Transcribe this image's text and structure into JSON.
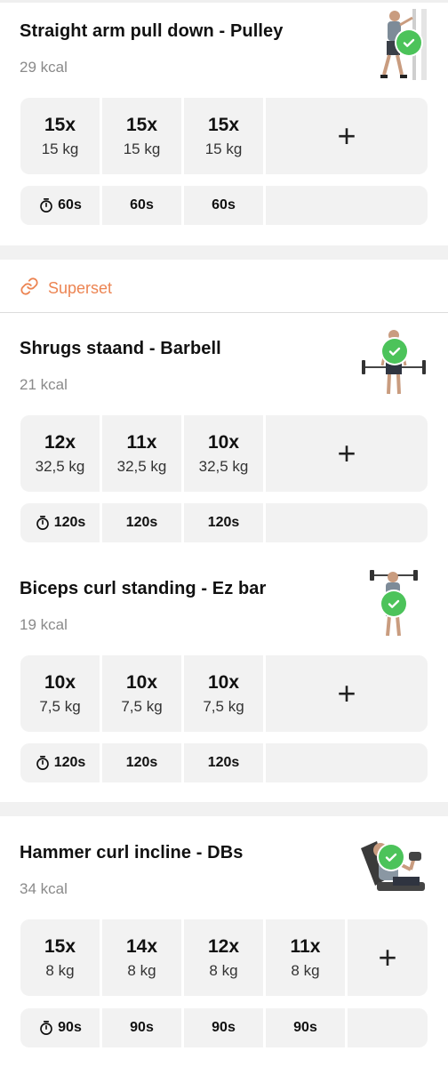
{
  "superset": {
    "label": "Superset"
  },
  "exercises": [
    {
      "title": "Straight arm pull down - Pulley",
      "kcal": "29 kcal",
      "sets": [
        {
          "reps": "15x",
          "weight": "15 kg"
        },
        {
          "reps": "15x",
          "weight": "15 kg"
        },
        {
          "reps": "15x",
          "weight": "15 kg"
        }
      ],
      "rests": [
        "60s",
        "60s",
        "60s"
      ],
      "completed": true
    },
    {
      "title": "Shrugs staand - Barbell",
      "kcal": "21 kcal",
      "sets": [
        {
          "reps": "12x",
          "weight": "32,5 kg"
        },
        {
          "reps": "11x",
          "weight": "32,5 kg"
        },
        {
          "reps": "10x",
          "weight": "32,5 kg"
        }
      ],
      "rests": [
        "120s",
        "120s",
        "120s"
      ],
      "completed": true
    },
    {
      "title": "Biceps curl standing - Ez bar",
      "kcal": "19 kcal",
      "sets": [
        {
          "reps": "10x",
          "weight": "7,5 kg"
        },
        {
          "reps": "10x",
          "weight": "7,5 kg"
        },
        {
          "reps": "10x",
          "weight": "7,5 kg"
        }
      ],
      "rests": [
        "120s",
        "120s",
        "120s"
      ],
      "completed": true
    },
    {
      "title": "Hammer curl incline - DBs",
      "kcal": "34 kcal",
      "sets": [
        {
          "reps": "15x",
          "weight": "8 kg"
        },
        {
          "reps": "14x",
          "weight": "8 kg"
        },
        {
          "reps": "12x",
          "weight": "8 kg"
        },
        {
          "reps": "11x",
          "weight": "8 kg"
        }
      ],
      "rests": [
        "90s",
        "90s",
        "90s",
        "90s"
      ],
      "completed": true
    }
  ],
  "colors": {
    "accent": "#ec8452",
    "check": "#4cc35a",
    "cell": "#f2f2f2",
    "divider": "#f1f1f1"
  },
  "icons": {
    "add": "plus-icon",
    "timer": "stopwatch-icon",
    "link": "link-icon",
    "done": "check-circle-icon"
  }
}
